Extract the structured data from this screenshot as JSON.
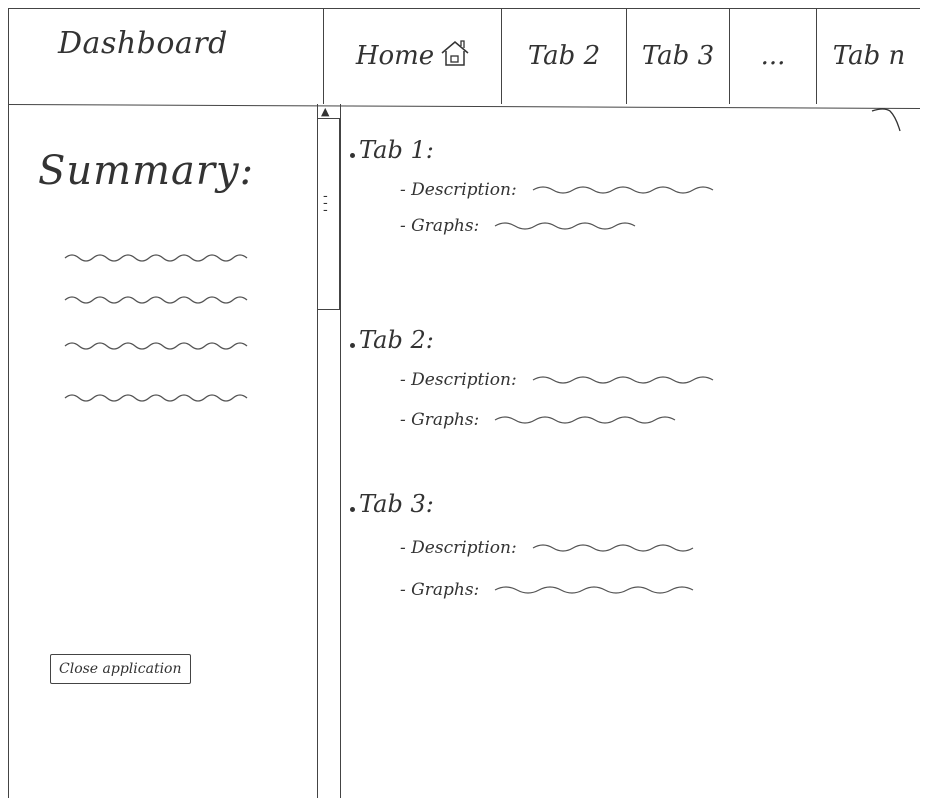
{
  "header": {
    "app_title": "Dashboard",
    "tabs": [
      {
        "label": "Home",
        "icon": "home-icon"
      },
      {
        "label": "Tab 2"
      },
      {
        "label": "Tab 3"
      },
      {
        "label": "..."
      },
      {
        "label": "Tab n"
      }
    ]
  },
  "sidebar": {
    "title": "Summary:",
    "close_button_label": "Close application"
  },
  "content": {
    "sections": [
      {
        "title": "Tab 1:",
        "description_label": "- Description:",
        "graphs_label": "- Graphs:"
      },
      {
        "title": "Tab 2:",
        "description_label": "- Description:",
        "graphs_label": "- Graphs:"
      },
      {
        "title": "Tab 3:",
        "description_label": "- Description:",
        "graphs_label": "- Graphs:"
      }
    ]
  },
  "colors": {
    "ink": "#333333",
    "paper": "#ffffff"
  }
}
